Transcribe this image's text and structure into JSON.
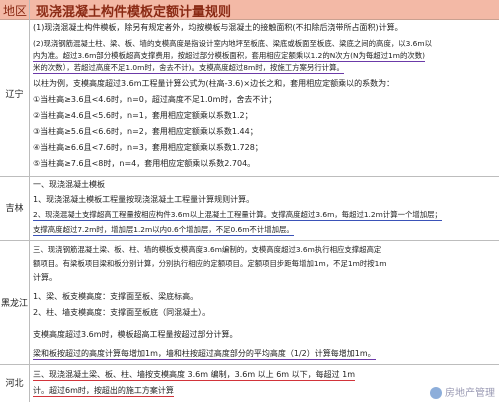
{
  "header": {
    "col_region": "地区",
    "col_rule": "现浇混凝土构件模板定额计量规则"
  },
  "sections": [
    {
      "region": "辽宁",
      "lines": [
        "(1)现浇混凝土构件模板，除另有规定者外，均按模板与混凝土的接触面积(不扣除后浇带所占面积)计算。",
        "(2)现浇钢筋混凝土柱、梁、板、墙的支模高度是指设计室内地坪至板底、梁底或板面至板底、梁底之间的高度，以3.6m以",
        "内为准。超过3.6m部分模板超高支撑费用，按超过部分模板面积，套用相应定额乘以1.2的N次方(N为每超过1m的次数)",
        "米的次数），若超过高度不足1.0m时，舍去不计)。支模高度超过8m时，按施工方案另行计算。",
        "以柱为例，支模高度超过3.6m工程量计算公式为(柱高-3.6)×边长之和，套用相应定额乘以的系数为：",
        "①当柱高≥3.6且<4.6时，n=0，超过高度不足1.0m时，舍去不计；",
        "②当柱高≥4.6且<5.6时，n=1，套用相应定额乘以系数1.2；",
        "③当柱高≥5.6且<6.6时，n=2，套用相应定额乘以系数1.44；",
        "④当柱高≥6.6且<7.6时，n=3，套用相应定额乘以系数1.728；",
        "⑤当柱高≥7.6且<8时，n=4，套用相应定额乘以系数2.704。"
      ]
    },
    {
      "region": "吉林",
      "lines": [
        "一、现浇混凝土模板",
        "1、现浇混凝土模板工程量按现浇混凝土工程量计算规则计算。",
        "2、现浇混凝土支撑超高工程量按相应构件3.6m以上混凝土工程量计算。支撑高度超过3.6m，每超过1.2m计算一个增加层；",
        "支撑高度超过7.2m时，增加层1.2m以内0.6个增加层，不足0.6m不计增加层。"
      ]
    },
    {
      "region": "黑龙江",
      "lines": [
        "三、现浇钢筋混凝土梁、板、柱、墙的模板支模高度3.6m编制的，支模高度超过3.6m执行相应支撑超高定",
        "额项目。有梁板项目梁和板分别计算，分别执行相应的定额项目。定额项目步距每增加1m，不足1m时按1m",
        "计算。",
        "1、梁、板支模高度：支撑面至板、梁底标高。",
        "2、柱、墙支模高度：支撑面至板底（同混凝土）。",
        "支模高度超过3.6m时，模板超高工程量按超过部分计算。",
        "梁和板按超过的高度计算每增加1m，墙和柱按超过高度部分的平均高度（1/2）计算每增加1m。"
      ]
    },
    {
      "region": "河北",
      "lines": [
        "三、现浇混凝土梁、板、柱、墙按支模高度 3.6m 编制，3.6m 以上 6m 以下，每超过 1m",
        "计。超过6m时，按超出的施工方案计算"
      ]
    }
  ],
  "watermark": "房地产管理"
}
